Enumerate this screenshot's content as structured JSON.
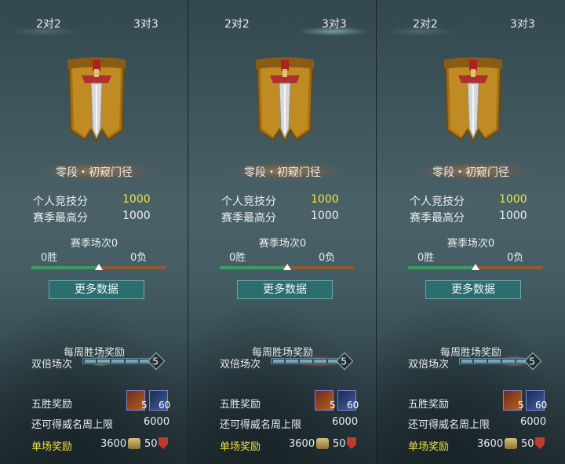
{
  "panels": [
    {
      "tabs": [
        "2对2",
        "3对3"
      ],
      "active_tab": 0,
      "rank_name": "零段・初窥门径",
      "personal_score_label": "个人竞技分",
      "personal_score": "1000",
      "season_high_label": "赛季最高分",
      "season_high": "1000",
      "season_matches": "赛季场次0",
      "wins": "0胜",
      "losses": "0负",
      "win_ratio": 0.5,
      "more_button": "更多数据",
      "weekly_title": "每周胜场奖励",
      "double_label": "双倍场次",
      "double_count": "5",
      "five_win_label": "五胜奖励",
      "item1_qty": "5",
      "item2_qty": "60",
      "cap_label": "还可得威名周上限",
      "cap_value": "6000",
      "single_label": "单场奖励",
      "single_value1": "3600",
      "single_value2": "50"
    },
    {
      "tabs": [
        "2对2",
        "3对3"
      ],
      "active_tab": 1,
      "rank_name": "零段・初窥门径",
      "personal_score_label": "个人竞技分",
      "personal_score": "1000",
      "season_high_label": "赛季最高分",
      "season_high": "1000",
      "season_matches": "赛季场次0",
      "wins": "0胜",
      "losses": "0负",
      "win_ratio": 0.5,
      "more_button": "更多数据",
      "weekly_title": "每周胜场奖励",
      "double_label": "双倍场次",
      "double_count": "5",
      "five_win_label": "五胜奖励",
      "item1_qty": "5",
      "item2_qty": "60",
      "cap_label": "还可得威名周上限",
      "cap_value": "6000",
      "single_label": "单场奖励",
      "single_value1": "3600",
      "single_value2": "50"
    },
    {
      "tabs": [
        "2对2",
        "3对3"
      ],
      "active_tab": 0,
      "rank_name": "零段・初窥门径",
      "personal_score_label": "个人竞技分",
      "personal_score": "1000",
      "season_high_label": "赛季最高分",
      "season_high": "1000",
      "season_matches": "赛季场次0",
      "wins": "0胜",
      "losses": "0负",
      "win_ratio": 0.5,
      "more_button": "更多数据",
      "weekly_title": "每周胜场奖励",
      "double_label": "双倍场次",
      "double_count": "5",
      "five_win_label": "五胜奖励",
      "item1_qty": "5",
      "item2_qty": "60",
      "cap_label": "还可得威名周上限",
      "cap_value": "6000",
      "single_label": "单场奖励",
      "single_value1": "3600",
      "single_value2": "50"
    }
  ],
  "colors": {
    "score_yellow": "#f3e63a",
    "win_green": "#3f9a61",
    "loss_brown": "#8c5a33",
    "button_teal": "#2c6d70"
  },
  "icons": [
    "rank-badge-sword-banner-icon",
    "gold-coin-icon",
    "red-shield-icon",
    "treasure-item-icon",
    "feather-item-icon"
  ]
}
